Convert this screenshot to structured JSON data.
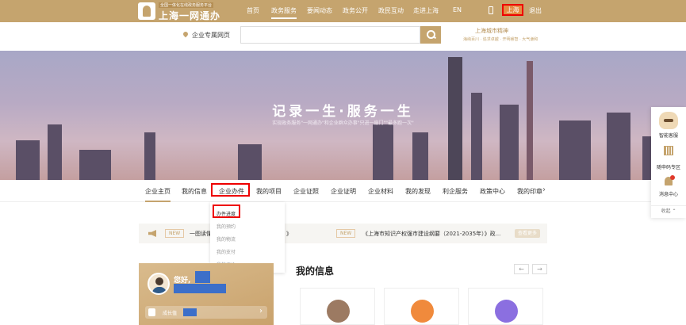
{
  "header": {
    "logo_sub": "全国一体化在线政务服务平台",
    "logo_title": "上海一网通办",
    "nav": [
      "首页",
      "政务服务",
      "要闻动态",
      "政务公开",
      "政民互动",
      "走进上海",
      "EN"
    ],
    "active_nav": "政务服务",
    "location": "上海",
    "logout": "退出"
  },
  "search": {
    "location_label": "企业专属网页",
    "placeholder": "",
    "brand_main": "上海城市精神",
    "brand_sub": "海纳百川 · 追求卓越 · 开明睿智 · 大气谦和"
  },
  "banner": {
    "title": "记录一生·服务一生",
    "subtitle": "实现政务服务\"一网通办\"和企业群众办事\"只进一扇门\"\"最多跑一次\""
  },
  "tabs": [
    "企业主页",
    "我的信息",
    "企业办件",
    "我的项目",
    "企业证照",
    "企业证明",
    "企业材料",
    "我的发现",
    "利企服务",
    "政策中心",
    "我的印章"
  ],
  "dropdown": [
    "办件进度",
    "我的预约",
    "我的物流",
    "我的支付",
    "我的评价"
  ],
  "notice": {
    "badge": "NEW",
    "item1": "一图读懂",
    "item1_tail": "》",
    "item2": "《上海市知识产权强市建设纲要（2021-2035年）》政...",
    "more": "查看更多"
  },
  "profile": {
    "greeting": "您好,",
    "growth_label": "成长值"
  },
  "section_title": "我的信息",
  "sidebar": {
    "service": "智能客服",
    "qr": "随申码专区",
    "messages": "消息中心",
    "collapse": "收起 ⌃"
  },
  "colors": {
    "brand": "#c5a46e",
    "highlight": "#e00000",
    "mask": "#3c6fc9"
  }
}
